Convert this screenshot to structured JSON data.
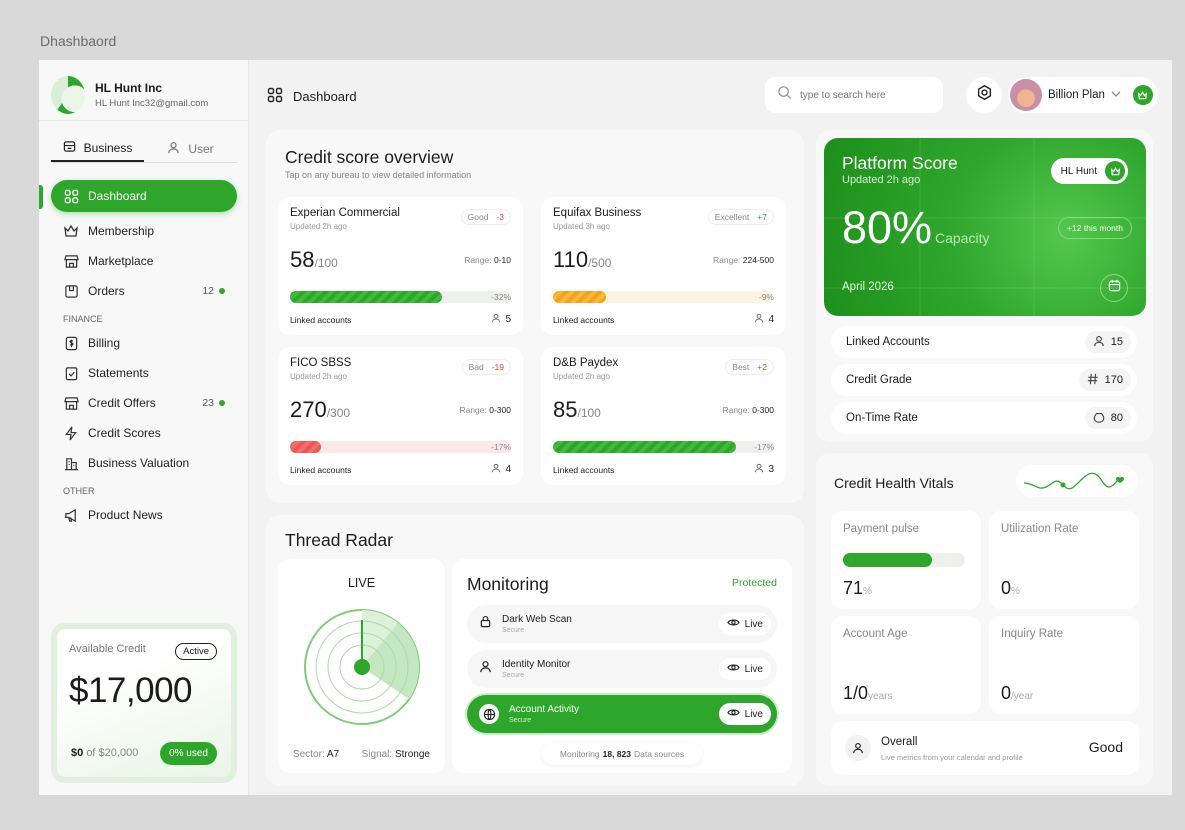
{
  "frame_label": "Dhashbaord",
  "profile": {
    "company": "HL Hunt Inc",
    "email": "HL Hunt Inc32@gmail.com"
  },
  "tabs": {
    "business": "Business",
    "user": "User"
  },
  "nav": {
    "dashboard": "Dashboard",
    "membership": "Membership",
    "marketplace": "Marketplace",
    "orders": "Orders",
    "orders_count": "12",
    "finance_heading": "FINANCE",
    "billing": "Billing",
    "statements": "Statements",
    "credit_offers": "Credit Offers",
    "credit_offers_count": "23",
    "credit_scores": "Credit Scores",
    "business_valuation": "Business Valuation",
    "other_heading": "OTHER",
    "product_news": "Product News"
  },
  "available_credit": {
    "label": "Available Credit",
    "status": "Active",
    "amount": "$17,000",
    "used_amount": "$0",
    "of_label": "of $20,000",
    "used_badge": "0% used"
  },
  "header": {
    "breadcrumb": "Dashboard",
    "search_placeholder": "type to search here",
    "plan_name": "Billion Plan"
  },
  "credit_overview": {
    "title": "Credit score overview",
    "subtitle": "Tap on any bureau to view detailed information",
    "linked_label": "Linked accounts",
    "bureaus": [
      {
        "name": "Experian Commercial",
        "updated": "Updated 2h ago",
        "rating": "Good",
        "delta": "-3",
        "delta_color": "#e04848",
        "score": "58",
        "max": "/100",
        "range_label": "Range:",
        "range": "0-10",
        "fill_fraction": 0.69,
        "bar": "green",
        "trend": "-32%",
        "linked": "5"
      },
      {
        "name": "Equifax Business",
        "updated": "Updated 3h ago",
        "rating": "Excellent",
        "delta": "+7",
        "delta_color": "#2ea62b",
        "score": "110",
        "max": "/500",
        "range_label": "Range:",
        "range": "224-500",
        "fill_fraction": 0.24,
        "bar": "orange",
        "trend": "-9%",
        "linked": "4"
      },
      {
        "name": "FICO SBSS",
        "updated": "Updated 2h ago",
        "rating": "Bad",
        "delta": "-19",
        "delta_color": "#e04848",
        "score": "270",
        "max": "/300",
        "range_label": "Range:",
        "range": "0-300",
        "fill_fraction": 0.14,
        "bar": "red",
        "trend": "-17%",
        "linked": "4"
      },
      {
        "name": "D&B Paydex",
        "updated": "Updated 2h ago",
        "rating": "Best",
        "delta": "+2",
        "delta_color": "#2ea62b",
        "score": "85",
        "max": "/100",
        "range_label": "Range:",
        "range": "0-300",
        "fill_fraction": 0.83,
        "bar": "green",
        "trend": "-17%",
        "linked": "3"
      }
    ]
  },
  "thread_radar": {
    "title": "Thread Radar",
    "live": "LIVE",
    "sector_label": "Sector:",
    "sector": "A7",
    "signal_label": "Signal:",
    "signal": "Stronge"
  },
  "monitoring": {
    "title": "Monitoring",
    "status": "Protected",
    "rows": [
      {
        "name": "Dark Web Scan",
        "sub": "Secure",
        "live": "Live"
      },
      {
        "name": "Identity Monitor",
        "sub": "Secure",
        "live": "Live"
      },
      {
        "name": "Account Activity",
        "sub": "Secure",
        "live": "Live"
      }
    ],
    "footer_prefix": "Monitoring",
    "footer_count": "18, 823",
    "footer_suffix": "Data sources"
  },
  "platform": {
    "title": "Platform Score",
    "updated": "Updated 2h ago",
    "badge": "HL Hunt",
    "percent": "80%",
    "capacity": "Capacity",
    "this_month": "+12 this month",
    "date": "April 2026"
  },
  "stats": [
    {
      "label": "Linked Accounts",
      "value": "15",
      "icon": "user-icon"
    },
    {
      "label": "Credit Grade",
      "value": "170",
      "icon": "hash-icon"
    },
    {
      "label": "On-Time Rate",
      "value": "80",
      "icon": "bag-icon"
    }
  ],
  "vitals": {
    "title": "Credit Health Vitals",
    "payment_pulse": {
      "label": "Payment pulse",
      "value": "71",
      "unit": "%",
      "fill_fraction": 0.73
    },
    "utilization": {
      "label": "Utilization Rate",
      "value": "0",
      "unit": "%"
    },
    "account_age": {
      "label": "Account Age",
      "value": "1/0",
      "unit": "years"
    },
    "inquiry": {
      "label": "Inquiry Rate",
      "value": "0",
      "unit": "/year"
    },
    "overall": {
      "label": "Overall",
      "sub": "Live metrics from your calendar and profile",
      "value": "Good"
    }
  },
  "colors": {
    "accent": "#2ea62b",
    "warning": "#f5a217",
    "danger": "#f05454"
  }
}
